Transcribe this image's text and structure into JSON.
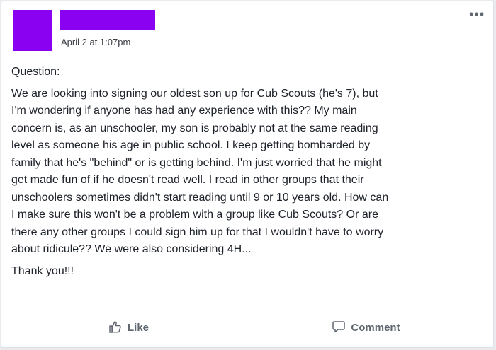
{
  "post": {
    "timestamp": "April 2 at 1:07pm",
    "more_glyph": "•••",
    "heading": "Question:",
    "lines": [
      "We are looking into signing our oldest son up for Cub Scouts (he's 7), but",
      "I'm wondering if anyone has had any experience with this?? My main",
      "concern is, as an unschooler, my son is probably not at the same reading",
      "level as someone his age in public school. I keep getting bombarded by",
      "family that he's \"behind\" or is getting behind. I'm just worried that he might",
      "get made fun of if he doesn't read well. I read in other groups that their",
      "unschoolers sometimes didn't start reading until 9 or 10 years old. How can",
      "I make sure this won't be a problem with a group like Cub Scouts? Or are",
      "there any other groups I could sign him up for that I wouldn't have to worry",
      "about ridicule?? We were also considering 4H..."
    ],
    "thanks": "Thank you!!!"
  },
  "actions": {
    "like_label": "Like",
    "comment_label": "Comment"
  },
  "colors": {
    "redaction": "#8a00f0",
    "action_text": "#606770"
  },
  "icons": {
    "like": "thumbs-up-icon",
    "comment": "comment-bubble-icon",
    "more": "more-options-icon"
  }
}
